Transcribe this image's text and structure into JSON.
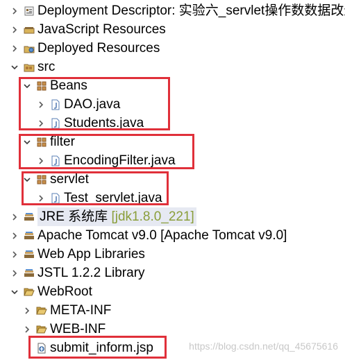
{
  "tree": {
    "items": [
      {
        "label": "Deployment Descriptor: 实验六_servlet操作数数据改进",
        "icon": "deployment-descriptor-icon",
        "twisty": "collapsed"
      },
      {
        "label": "JavaScript Resources",
        "icon": "javascript-resources-icon",
        "twisty": "collapsed"
      },
      {
        "label": "Deployed Resources",
        "icon": "deployed-resources-icon",
        "twisty": "collapsed"
      },
      {
        "label": "src",
        "icon": "source-folder-icon",
        "twisty": "expanded"
      },
      {
        "label": "Beans",
        "icon": "package-icon",
        "twisty": "expanded"
      },
      {
        "label": "DAO.java",
        "icon": "java-file-icon",
        "twisty": "collapsed"
      },
      {
        "label": "Students.java",
        "icon": "java-file-icon",
        "twisty": "collapsed"
      },
      {
        "label": "filter",
        "icon": "package-icon",
        "twisty": "expanded"
      },
      {
        "label": "EncodingFilter.java",
        "icon": "java-file-icon",
        "twisty": "collapsed"
      },
      {
        "label": "servlet",
        "icon": "package-icon",
        "twisty": "expanded"
      },
      {
        "label": "Test_servlet.java",
        "icon": "java-file-icon",
        "twisty": "collapsed"
      },
      {
        "label": "JRE 系统库",
        "decoration": "[jdk1.8.0_221]",
        "icon": "library-icon",
        "twisty": "collapsed"
      },
      {
        "label": "Apache Tomcat v9.0 [Apache Tomcat v9.0]",
        "icon": "library-icon",
        "twisty": "collapsed"
      },
      {
        "label": "Web App Libraries",
        "icon": "library-icon",
        "twisty": "collapsed"
      },
      {
        "label": "JSTL 1.2.2 Library",
        "icon": "library-icon",
        "twisty": "collapsed"
      },
      {
        "label": "WebRoot",
        "icon": "folder-icon",
        "twisty": "expanded"
      },
      {
        "label": "META-INF",
        "icon": "folder-icon",
        "twisty": "collapsed"
      },
      {
        "label": "WEB-INF",
        "icon": "folder-icon",
        "twisty": "collapsed"
      },
      {
        "label": "submit_inform.jsp",
        "icon": "jsp-file-icon",
        "twisty": "none"
      }
    ]
  },
  "watermark": "https://blog.csdn.net/qq_45675616",
  "colors": {
    "highlight_border": "#e0303a",
    "decoration_text": "#8a9e3a",
    "package_icon": "#b07a3a",
    "java_icon": "#5a7fb5",
    "folder_icon": "#d9b45a",
    "library_icon": "#8a6a3a"
  }
}
